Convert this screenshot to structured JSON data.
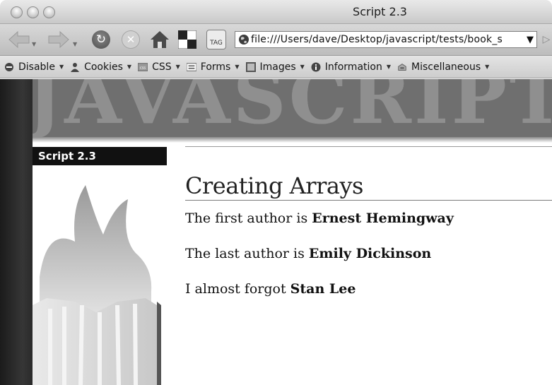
{
  "window": {
    "title": "Script 2.3"
  },
  "navigation": {
    "url": "file:///Users/dave/Desktop/javascript/tests/book_s",
    "tag_label": "TAG"
  },
  "devtoolbar": {
    "items": [
      {
        "label": "Disable",
        "icon": "no-entry-icon"
      },
      {
        "label": "Cookies",
        "icon": "person-icon"
      },
      {
        "label": "CSS",
        "icon": "css-icon"
      },
      {
        "label": "Forms",
        "icon": "form-icon"
      },
      {
        "label": "Images",
        "icon": "image-icon"
      },
      {
        "label": "Information",
        "icon": "info-icon"
      },
      {
        "label": "Miscellaneous",
        "icon": "misc-icon"
      }
    ]
  },
  "page": {
    "banner": "JAVASCRIPT",
    "script_label": "Script 2.3",
    "heading": "Creating Arrays",
    "lines": [
      {
        "prefix": "The first author is ",
        "name": "Ernest Hemingway"
      },
      {
        "prefix": "The last author is ",
        "name": "Emily Dickinson"
      },
      {
        "prefix": "I almost forgot ",
        "name": "Stan Lee"
      }
    ]
  },
  "colors": {
    "banner_bg": "#6f6f6f",
    "banner_text": "#8f8f8f",
    "label_bg": "#111111"
  }
}
